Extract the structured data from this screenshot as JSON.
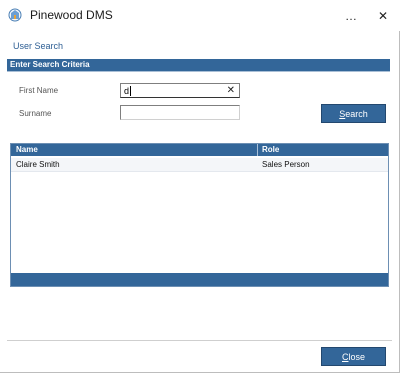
{
  "window": {
    "title": "Pinewood DMS",
    "minimize_glyph": "…",
    "close_glyph": "✕"
  },
  "section_link": "User Search",
  "criteria_header": "Enter Search Criteria",
  "form": {
    "first_name_label": "First Name",
    "first_name_value": "d",
    "clear_glyph": "✕",
    "surname_label": "Surname",
    "surname_value": ""
  },
  "buttons": {
    "search_first": "S",
    "search_rest": "earch",
    "close_first": "C",
    "close_rest": "lose"
  },
  "grid": {
    "columns": [
      "Name",
      "Role"
    ],
    "rows": [
      {
        "name": "Claire Smith",
        "role": "Sales Person"
      }
    ]
  },
  "colors": {
    "accent": "#336699",
    "link": "#2e5f94"
  }
}
